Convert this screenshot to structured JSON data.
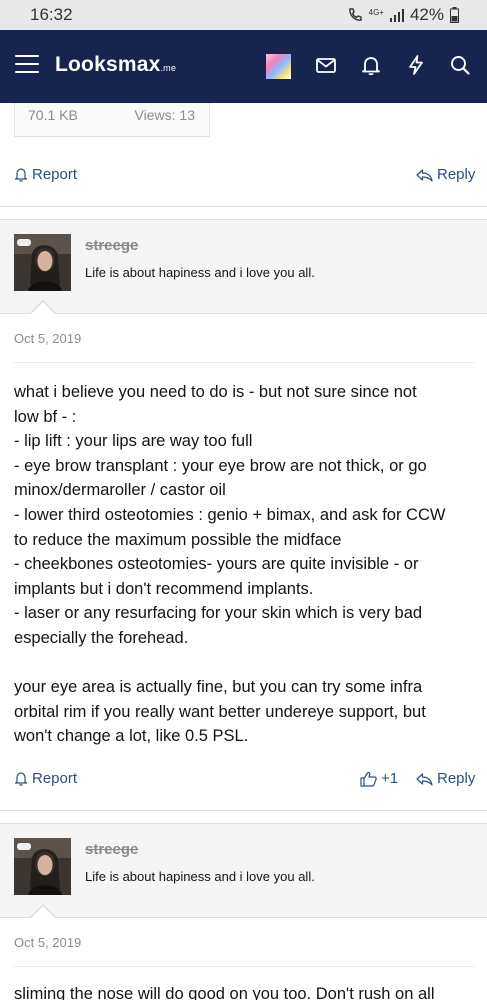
{
  "status_bar": {
    "time": "16:32",
    "network": "4G+",
    "battery": "42%"
  },
  "header": {
    "logo_main": "Looksmax",
    "logo_suffix": ".me"
  },
  "attachment": {
    "size": "70.1 KB",
    "views": "Views: 13"
  },
  "post_actions_top": {
    "report": "Report",
    "reply": "Reply"
  },
  "posts": [
    {
      "username": "streege",
      "user_title": "Life is about hapiness and i love you all.",
      "date": "Oct 5, 2019",
      "lines": [
        "what i believe you need to do is - but not sure since not",
        "low bf - :",
        "- lip lift : your lips are way too full",
        "- eye brow transplant : your eye brow are not thick, or go",
        "minox/dermaroller / castor oil",
        "- lower third osteotomies : genio + bimax, and ask for CCW",
        "to reduce the maximum possible the midface",
        "- cheekbones osteotomies- yours are quite invisible - or",
        "implants but i don't recommend implants.",
        "- laser or any resurfacing for your skin which is very bad",
        "especially the forehead.",
        "",
        "your eye area is actually fine, but you can try some infra",
        "orbital rim if you really want better undereye support, but",
        "won't change a lot, like 0.5 PSL."
      ],
      "report": "Report",
      "reactions": "+1",
      "reply": "Reply"
    },
    {
      "username": "streege",
      "user_title": "Life is about hapiness and i love you all.",
      "date": "Oct 5, 2019",
      "first_line": "sliming the nose will do good on you too. Don't rush on all"
    }
  ],
  "icons": [
    "menu-icon",
    "mail-icon",
    "bell-icon",
    "bolt-icon",
    "search-icon",
    "report-bell-icon",
    "reply-icon",
    "thumbs-up-icon"
  ],
  "colors": {
    "header_bg": "#16244f",
    "link": "#2b4f80",
    "user_block_bg": "#f5f5f5"
  }
}
